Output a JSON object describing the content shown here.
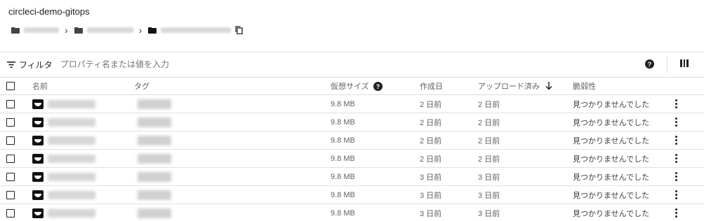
{
  "header": {
    "title": "circleci-demo-gitops"
  },
  "breadcrumb": {
    "items": [
      {
        "label": "",
        "icon": "folder-icon",
        "redacted": true
      },
      {
        "label": "",
        "icon": "folder-icon",
        "redacted": true
      },
      {
        "label": "",
        "icon": "folder-icon",
        "redacted": true
      }
    ],
    "separator": ">",
    "copy_icon": "copy-icon"
  },
  "filter": {
    "label": "フィルタ",
    "placeholder": "プロパティ名または値を入力",
    "icon": "filter-icon"
  },
  "toolbar": {
    "help_icon": "help-icon",
    "columns_icon": "columns-icon"
  },
  "table": {
    "columns": {
      "name": "名前",
      "tag": "タグ",
      "virtual_size": "仮想サイズ",
      "created": "作成日",
      "uploaded": "アップロード済み",
      "vulnerability": "脆弱性"
    },
    "rows": [
      {
        "size": "9.8 MB",
        "created": "2 日前",
        "uploaded": "2 日前",
        "vulnerability": "見つかりませんでした"
      },
      {
        "size": "9.8 MB",
        "created": "2 日前",
        "uploaded": "2 日前",
        "vulnerability": "見つかりませんでした"
      },
      {
        "size": "9.8 MB",
        "created": "2 日前",
        "uploaded": "2 日前",
        "vulnerability": "見つかりませんでした"
      },
      {
        "size": "9.8 MB",
        "created": "2 日前",
        "uploaded": "2 日前",
        "vulnerability": "見つかりませんでした"
      },
      {
        "size": "9.8 MB",
        "created": "3 日前",
        "uploaded": "3 日前",
        "vulnerability": "見つかりませんでした"
      },
      {
        "size": "9.8 MB",
        "created": "3 日前",
        "uploaded": "3 日前",
        "vulnerability": "見つかりませんでした"
      },
      {
        "size": "9.8 MB",
        "created": "3 日前",
        "uploaded": "3 日前",
        "vulnerability": "見つかりませんでした"
      }
    ]
  },
  "colors": {
    "text": "#202124",
    "muted": "#5f6368",
    "divider": "#dadce0"
  }
}
